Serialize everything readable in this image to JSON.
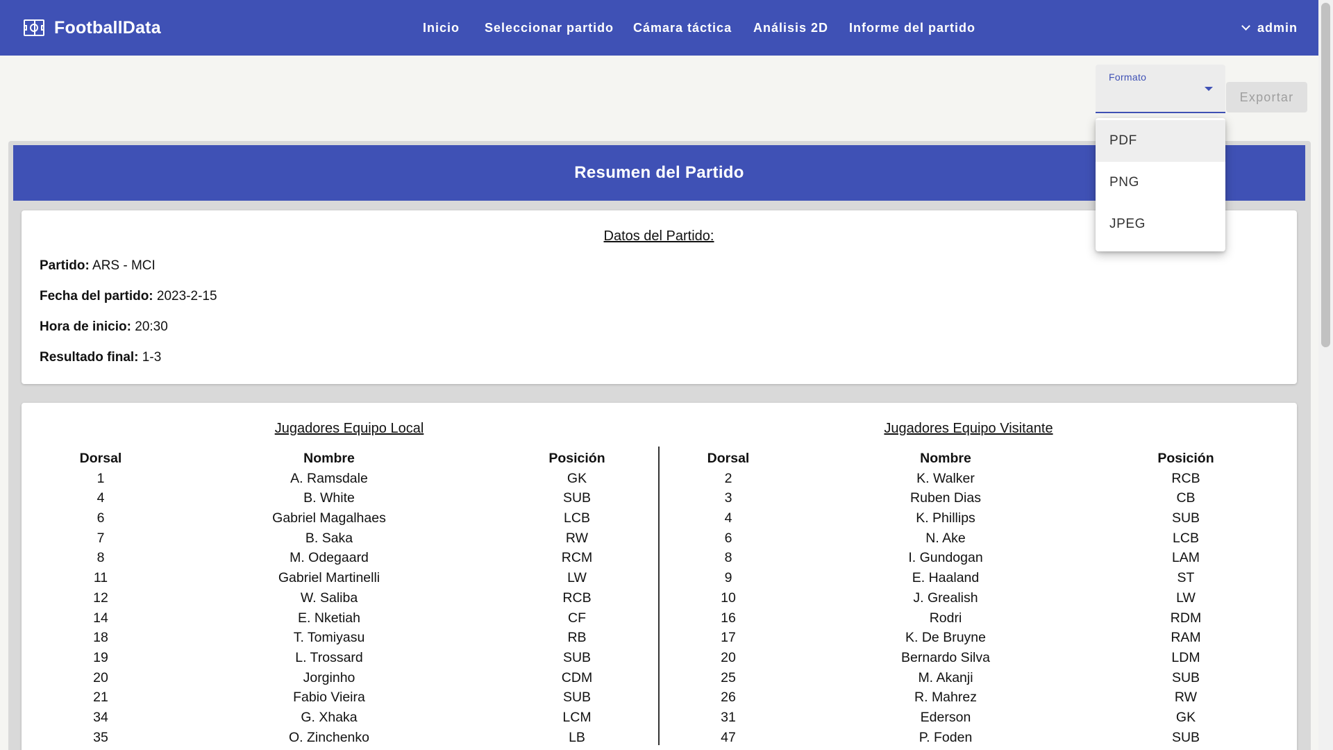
{
  "topbar": {
    "brand": "FootballData",
    "nav": [
      "Inicio",
      "Seleccionar partido",
      "Cámara táctica",
      "Análisis 2D",
      "Informe del partido"
    ],
    "user": "admin"
  },
  "export": {
    "format_label": "Formato",
    "format_value": "",
    "button": "Exportar",
    "options": [
      "PDF",
      "PNG",
      "JPEG"
    ],
    "highlighted": "PDF"
  },
  "summary": {
    "title": "Resumen del Partido",
    "datos_title": "Datos del Partido:",
    "fields": [
      {
        "label": "Partido:",
        "value": "ARS - MCI"
      },
      {
        "label": "Fecha del partido:",
        "value": "2023-2-15"
      },
      {
        "label": "Hora de inicio:",
        "value": "20:30"
      },
      {
        "label": "Resultado final:",
        "value": "1-3"
      }
    ]
  },
  "local": {
    "title": "Jugadores Equipo Local",
    "headers": [
      "Dorsal",
      "Nombre",
      "Posición"
    ],
    "rows": [
      [
        "1",
        "A. Ramsdale",
        "GK"
      ],
      [
        "4",
        "B. White",
        "SUB"
      ],
      [
        "6",
        "Gabriel Magalhaes",
        "LCB"
      ],
      [
        "7",
        "B. Saka",
        "RW"
      ],
      [
        "8",
        "M. Odegaard",
        "RCM"
      ],
      [
        "11",
        "Gabriel Martinelli",
        "LW"
      ],
      [
        "12",
        "W. Saliba",
        "RCB"
      ],
      [
        "14",
        "E. Nketiah",
        "CF"
      ],
      [
        "18",
        "T. Tomiyasu",
        "RB"
      ],
      [
        "19",
        "L. Trossard",
        "SUB"
      ],
      [
        "20",
        "Jorginho",
        "CDM"
      ],
      [
        "21",
        "Fabio Vieira",
        "SUB"
      ],
      [
        "34",
        "G. Xhaka",
        "LCM"
      ],
      [
        "35",
        "O. Zinchenko",
        "LB"
      ]
    ]
  },
  "visitante": {
    "title": "Jugadores Equipo Visitante",
    "headers": [
      "Dorsal",
      "Nombre",
      "Posición"
    ],
    "rows": [
      [
        "2",
        "K. Walker",
        "RCB"
      ],
      [
        "3",
        "Ruben Dias",
        "CB"
      ],
      [
        "4",
        "K. Phillips",
        "SUB"
      ],
      [
        "6",
        "N. Ake",
        "LCB"
      ],
      [
        "8",
        "I. Gundogan",
        "LAM"
      ],
      [
        "9",
        "E. Haaland",
        "ST"
      ],
      [
        "10",
        "J. Grealish",
        "LW"
      ],
      [
        "16",
        "Rodri",
        "RDM"
      ],
      [
        "17",
        "K. De Bruyne",
        "RAM"
      ],
      [
        "20",
        "Bernardo Silva",
        "LDM"
      ],
      [
        "25",
        "M. Akanji",
        "SUB"
      ],
      [
        "26",
        "R. Mahrez",
        "RW"
      ],
      [
        "31",
        "Ederson",
        "GK"
      ],
      [
        "47",
        "P. Foden",
        "SUB"
      ]
    ]
  },
  "colors": {
    "primary": "#3f51b5",
    "background": "#f5f5f2"
  }
}
